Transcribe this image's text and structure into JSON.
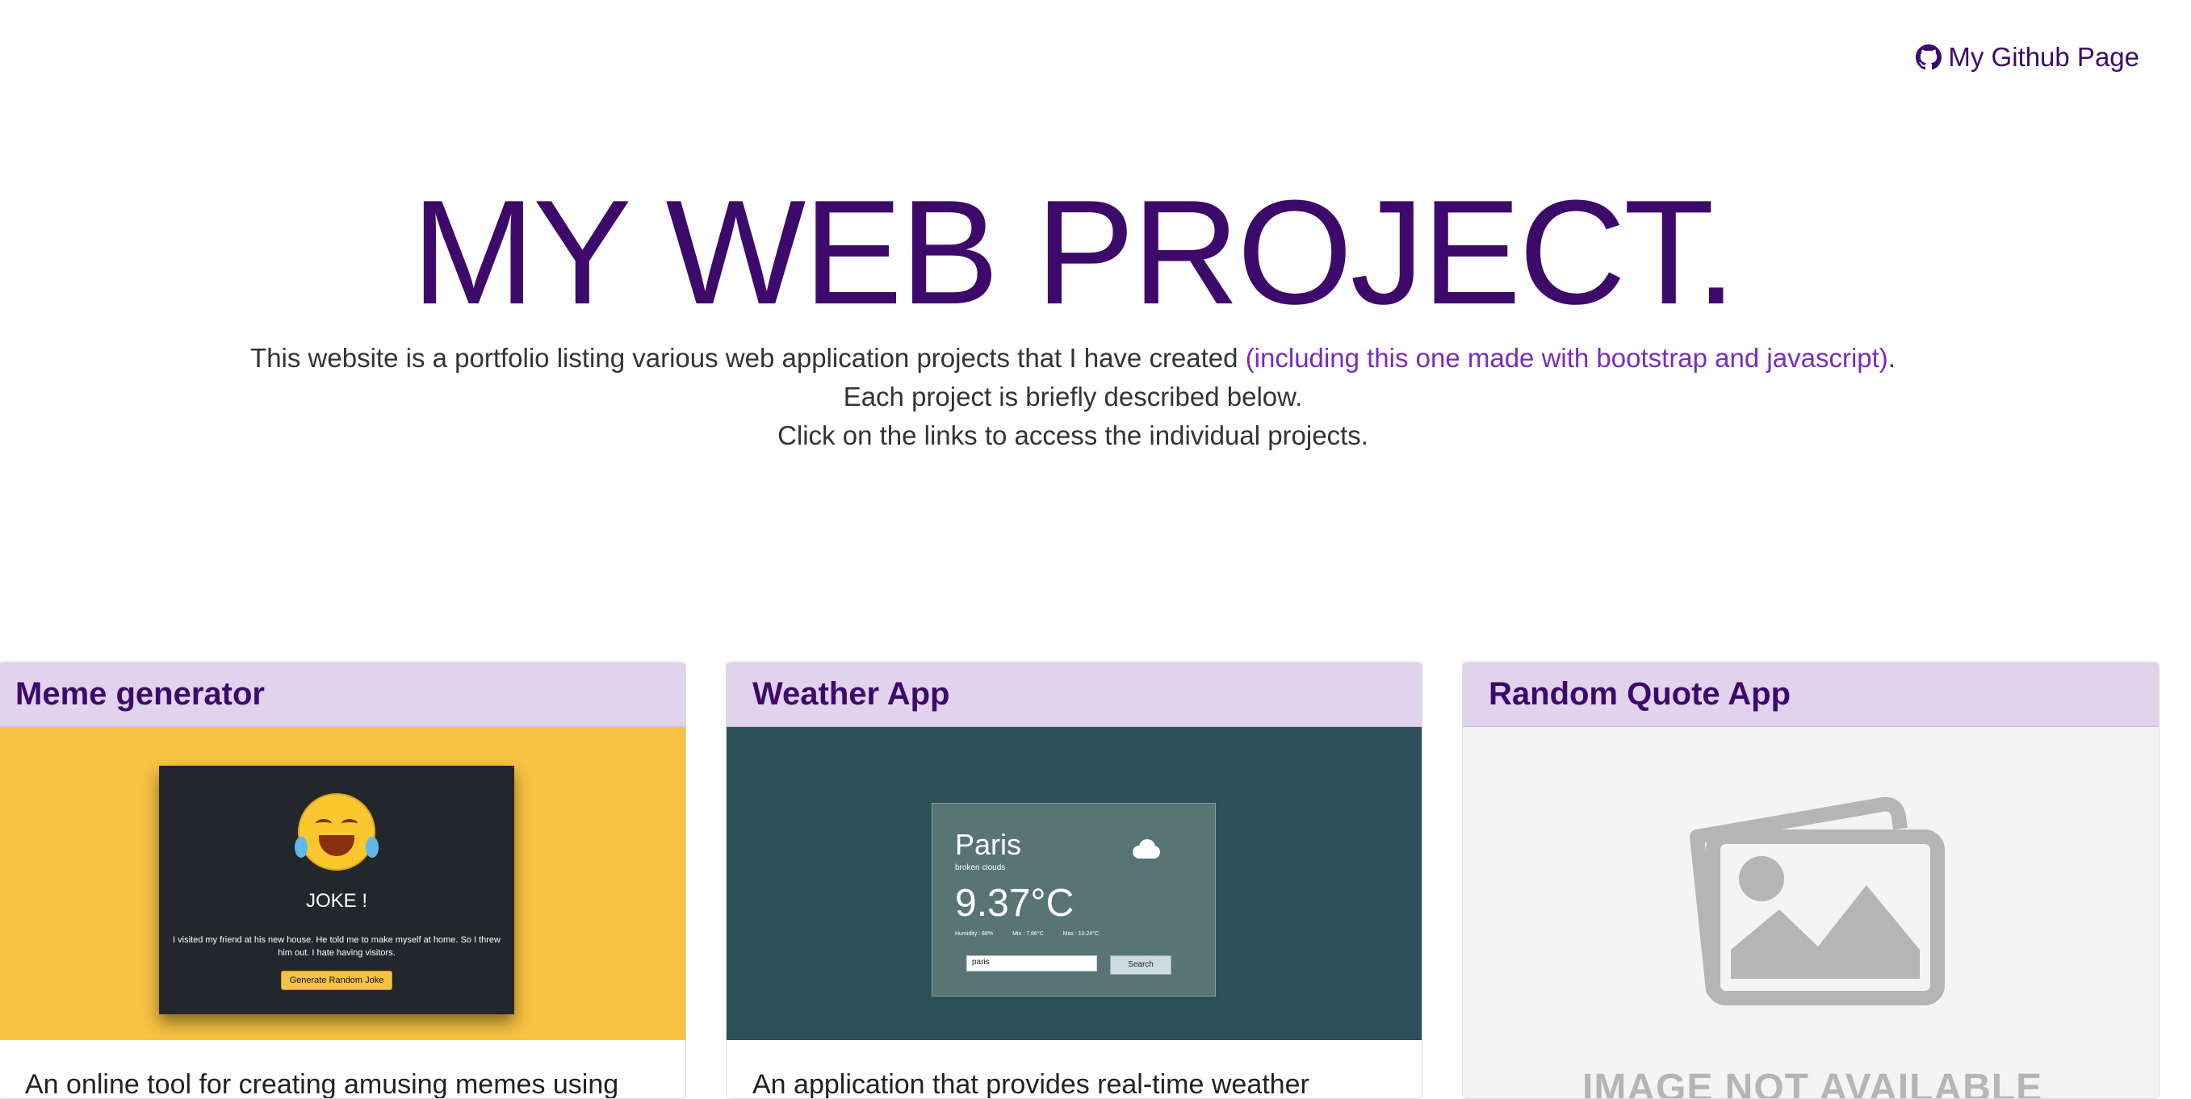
{
  "header": {
    "github_link": "My Github Page",
    "github_icon": "github-icon"
  },
  "hero": {
    "title": "MY WEB PROJECT.",
    "line1_before": "This website is a portfolio listing various web application projects that I have created ",
    "line1_accent": "(including this one made with bootstrap and javascript)",
    "line1_after": ".",
    "line2": "Each project is briefly described below.",
    "line3": "Click on the links to access the individual projects."
  },
  "cards": [
    {
      "title": "Meme generator",
      "text": "An online tool for creating amusing memes using",
      "preview": {
        "emoji": "crying-laughing-emoji-icon",
        "heading": "JOKE !",
        "joke": "I visited my friend at his new house. He told me to make myself at home. So I threw him out. I hate having visitors.",
        "button": "Generate Random Joke"
      }
    },
    {
      "title": "Weather App",
      "text": "An application that provides real-time weather",
      "preview": {
        "city": "Paris",
        "description": "broken clouds",
        "temperature": "9.37°C",
        "humidity": "Humidity : 88%",
        "min": "Min : 7.86°C",
        "max": "Max : 10.24°C",
        "input_value": "paris",
        "button": "Search"
      }
    },
    {
      "title": "Random Quote App",
      "placeholder_text": "IMAGE NOT AVAILABLE",
      "placeholder_icon": "image-placeholder-icon"
    }
  ],
  "colors": {
    "primary": "#3d0a6b",
    "accent": "#7b2bbf",
    "card_header_bg": "#e1d3ec",
    "meme_bg": "#f5c242",
    "weather_bg": "#2c5058"
  }
}
